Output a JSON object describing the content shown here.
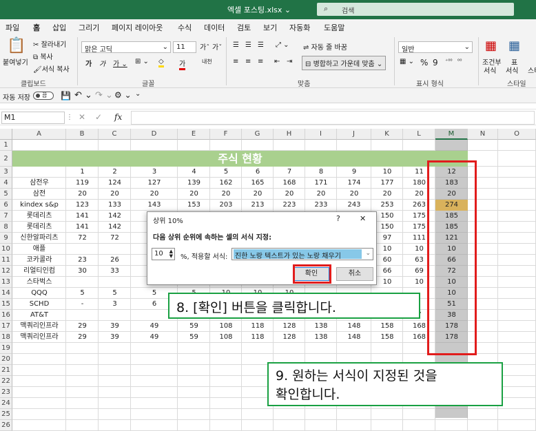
{
  "titlebar": {
    "filename": "엑셀 포스팅.xlsx",
    "search_placeholder": "검색"
  },
  "tabs": [
    "파일",
    "홈",
    "삽입",
    "그리기",
    "페이지 레이아웃",
    "수식",
    "데이터",
    "검토",
    "보기",
    "자동화",
    "도움말"
  ],
  "ribbon": {
    "paste": "붙여넣기",
    "cut": "잘라내기",
    "copy": "복사",
    "format_painter": "서식 복사",
    "font_name": "맑은 고딕",
    "font_size": "11",
    "wrap_text": "자동 줄 바꿈",
    "merge_center": "병합하고 가운데 맞춤",
    "number_format": "일반",
    "conditional": "조건부",
    "conditional2": "서식",
    "table": "표",
    "table2": "서식",
    "cellstyle": "스타",
    "groups": {
      "clipboard": "클립보드",
      "font": "글꼴",
      "align": "맞춤",
      "number": "표시 형식",
      "style": "스타일"
    }
  },
  "qat": {
    "autosave": "자동 저장",
    "toggle_state": "끔"
  },
  "formula_bar": {
    "namebox": "M1",
    "fx": "fx",
    "value": ""
  },
  "sheet": {
    "columns": [
      "A",
      "B",
      "C",
      "D",
      "E",
      "F",
      "G",
      "H",
      "I",
      "J",
      "K",
      "L",
      "M",
      "N",
      "O"
    ],
    "rows": [
      "1",
      "2",
      "3",
      "4",
      "5",
      "6",
      "7",
      "8",
      "9",
      "10",
      "11",
      "12",
      "13",
      "14",
      "15",
      "16",
      "17",
      "18",
      "19",
      "20",
      "21",
      "22",
      "23",
      "24",
      "25",
      "26"
    ],
    "title": "주식 현황",
    "data": [
      [
        "",
        "1",
        "2",
        "3",
        "4",
        "5",
        "6",
        "7",
        "8",
        "9",
        "10",
        "11",
        "12"
      ],
      [
        "삼전우",
        "119",
        "124",
        "127",
        "139",
        "162",
        "165",
        "168",
        "171",
        "174",
        "177",
        "180",
        "183"
      ],
      [
        "삼전",
        "20",
        "20",
        "20",
        "20",
        "20",
        "20",
        "20",
        "20",
        "20",
        "20",
        "20",
        "20"
      ],
      [
        "kindex s&p",
        "123",
        "133",
        "143",
        "153",
        "203",
        "213",
        "223",
        "233",
        "243",
        "253",
        "263",
        "274"
      ],
      [
        "롯데리츠",
        "141",
        "142",
        "",
        "",
        "",
        "",
        "",
        "",
        "",
        "150",
        "175",
        "185"
      ],
      [
        "롯데리츠",
        "141",
        "142",
        "",
        "",
        "",
        "",
        "",
        "",
        "",
        "150",
        "175",
        "185"
      ],
      [
        "신한알파리츠",
        "72",
        "72",
        "",
        "",
        "",
        "",
        "",
        "",
        "",
        "97",
        "111",
        "121"
      ],
      [
        "애플",
        "",
        "",
        "",
        "",
        "",
        "",
        "",
        "",
        "",
        "10",
        "10",
        "10"
      ],
      [
        "코카콜라",
        "23",
        "26",
        "",
        "",
        "",
        "",
        "",
        "",
        "",
        "60",
        "63",
        "66"
      ],
      [
        "리얼티인컴",
        "30",
        "33",
        "",
        "",
        "",
        "",
        "",
        "",
        "",
        "66",
        "69",
        "72"
      ],
      [
        "스타벅스",
        "",
        "",
        "",
        "",
        "",
        "",
        "",
        "",
        "",
        "10",
        "10",
        "10"
      ],
      [
        "QQQ",
        "5",
        "5",
        "5",
        "5",
        "10",
        "10",
        "10",
        "",
        "",
        "",
        "",
        "10"
      ],
      [
        "SCHD",
        "-",
        "3",
        "6",
        "",
        "",
        "",
        "",
        "",
        "",
        "",
        "",
        "51"
      ],
      [
        "AT&T",
        "",
        "",
        "",
        "",
        "",
        "",
        "",
        "",
        "",
        "",
        "7",
        "38"
      ],
      [
        "맥쿼리인프라",
        "29",
        "39",
        "49",
        "59",
        "108",
        "118",
        "128",
        "138",
        "148",
        "158",
        "168",
        "178"
      ],
      [
        "맥쿼리인프라",
        "29",
        "39",
        "49",
        "59",
        "108",
        "118",
        "128",
        "138",
        "148",
        "158",
        "168",
        "178"
      ]
    ],
    "highlight_color": "#d9b25c"
  },
  "dialog": {
    "title": "상위 10%",
    "help": "?",
    "close": "✕",
    "instruction": "다음 상위 순위에 속하는 셀의 서식 지정:",
    "spin_value": "10",
    "mid_label": "%, 적용할 서식:",
    "format_option": "진한 노랑 텍스트가 있는 노랑 채우기",
    "ok": "확인",
    "cancel": "취소"
  },
  "callouts": {
    "step8": "8. [확인] 버튼을 클릭합니다.",
    "step9_line1": "9. 원하는 서식이 지정된 것을",
    "step9_line2": "확인합니다."
  }
}
